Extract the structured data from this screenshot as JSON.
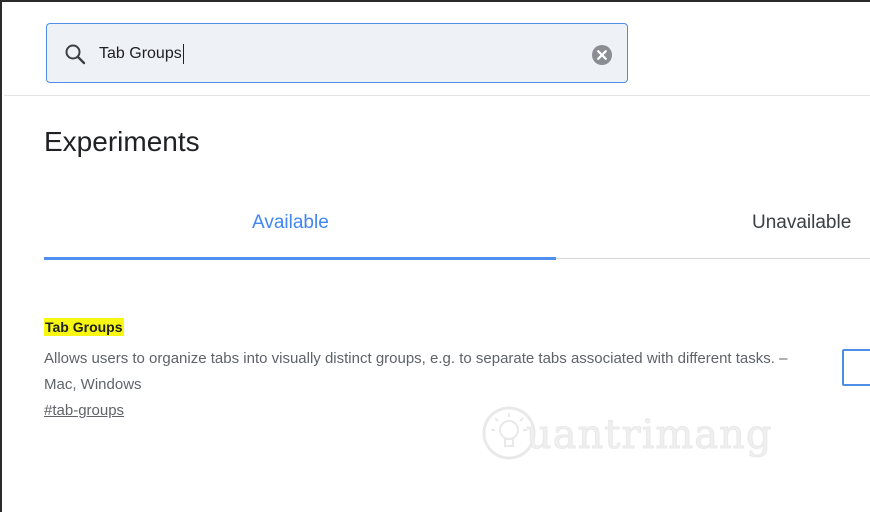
{
  "search": {
    "value": "Tab Groups"
  },
  "page": {
    "title": "Experiments"
  },
  "tabs": [
    {
      "label": "Available",
      "selected": true
    },
    {
      "label": "Unavailable",
      "selected": false
    }
  ],
  "experiments": [
    {
      "title": "Tab Groups",
      "description": "Allows users to organize tabs into visually distinct groups, e.g. to separate tabs associated with different tasks. – Mac, Windows",
      "link": "#tab-groups"
    }
  ],
  "watermark": {
    "text": "uantrimang"
  },
  "colors": {
    "accent": "#4285f4",
    "highlight": "#f7f711",
    "search_border": "#4d8ee6"
  }
}
